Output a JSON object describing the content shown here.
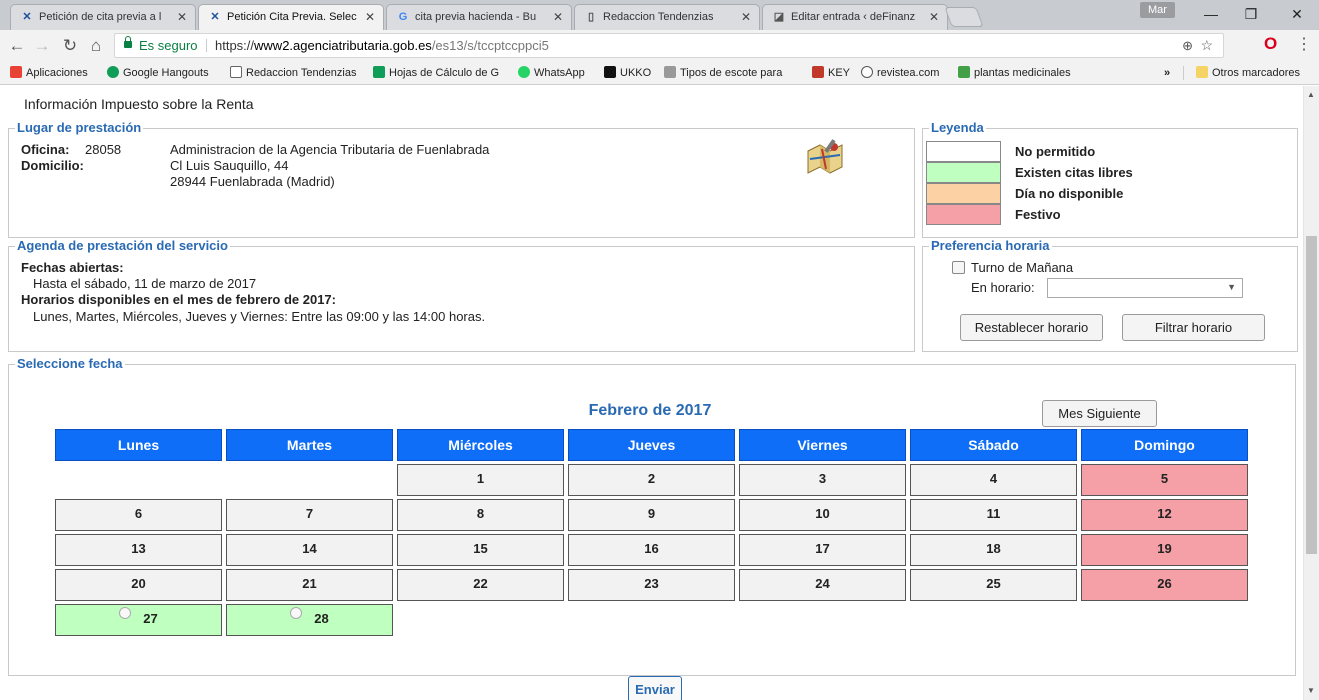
{
  "browser": {
    "tabs": [
      {
        "title": "Petición de cita previa a l",
        "icon": "aeat-icon"
      },
      {
        "title": "Petición Cita Previa. Selec",
        "icon": "aeat-icon"
      },
      {
        "title": "cita previa hacienda - Bu",
        "icon": "google-icon"
      },
      {
        "title": "Redaccion Tendenzias",
        "icon": "document-icon"
      },
      {
        "title": "Editar entrada ‹ deFinanz",
        "icon": "wordpress-icon"
      }
    ],
    "user_chip": "Mar",
    "secure_label": "Es seguro",
    "url_scheme": "https://",
    "url_host": "www2.agenciatributaria.gob.es",
    "url_path": "/es13/s/tccptccppci5",
    "bookmarks": [
      {
        "label": "Aplicaciones",
        "color": "#e94235"
      },
      {
        "label": "Google Hangouts",
        "color": "#0f9d58"
      },
      {
        "label": "Redaccion Tendenzias",
        "color": "#ffffff"
      },
      {
        "label": "Hojas de Cálculo de G",
        "color": "#0f9d58"
      },
      {
        "label": "WhatsApp",
        "color": "#25d366"
      },
      {
        "label": "UKKO",
        "color": "#111111"
      },
      {
        "label": "Tipos de escote para",
        "color": "#777777"
      },
      {
        "label": "KEY",
        "color": "#c0392b"
      },
      {
        "label": "revistea.com",
        "color": "#555555"
      },
      {
        "label": "plantas medicinales",
        "color": "#43a047"
      }
    ],
    "more_bookmarks": "»",
    "other_bookmarks": "Otros marcadores"
  },
  "page": {
    "top_text": "Información Impuesto sobre la Renta",
    "lugar": {
      "legend": "Lugar de prestación",
      "oficina_label": "Oficina:",
      "oficina_code": "28058",
      "oficina_name": "Administracion de la Agencia Tributaria de Fuenlabrada",
      "domicilio_label": "Domicilio:",
      "address_line1": "Cl Luis Sauquillo, 44",
      "address_line2": "28944 Fuenlabrada (Madrid)"
    },
    "leyenda": {
      "legend": "Leyenda",
      "items": [
        {
          "label": "No permitido",
          "color": "#ffffff"
        },
        {
          "label": "Existen citas libres",
          "color": "#bfffbf"
        },
        {
          "label": "Día no disponible",
          "color": "#fcd2a4"
        },
        {
          "label": "Festivo",
          "color": "#f4a0a6"
        }
      ]
    },
    "agenda": {
      "legend": "Agenda de prestación del servicio",
      "fechas_label": "Fechas abiertas:",
      "fechas_value": "Hasta el sábado, 11 de marzo de 2017",
      "horarios_label": "Horarios disponibles en el mes de febrero de 2017:",
      "horarios_value": "Lunes, Martes, Miércoles, Jueves y Viernes: Entre las 09:00 y las 14:00 horas."
    },
    "preferencia": {
      "legend": "Preferencia horaria",
      "turno_label": "Turno de Mañana",
      "horario_label": "En horario:",
      "horario_value": "",
      "reset_button": "Restablecer horario",
      "filter_button": "Filtrar horario"
    },
    "calendario": {
      "legend": "Seleccione fecha",
      "title": "Febrero de 2017",
      "next_button": "Mes Siguiente",
      "weekdays": [
        "Lunes",
        "Martes",
        "Miércoles",
        "Jueves",
        "Viernes",
        "Sábado",
        "Domingo"
      ],
      "weeks": [
        [
          null,
          null,
          "1",
          "2",
          "3",
          "4",
          "5"
        ],
        [
          "6",
          "7",
          "8",
          "9",
          "10",
          "11",
          "12"
        ],
        [
          "13",
          "14",
          "15",
          "16",
          "17",
          "18",
          "19"
        ],
        [
          "20",
          "21",
          "22",
          "23",
          "24",
          "25",
          "26"
        ],
        [
          "27",
          "28",
          null,
          null,
          null,
          null,
          null
        ]
      ],
      "festivos": [
        "5",
        "12",
        "19",
        "26"
      ],
      "libres": [
        "27",
        "28"
      ]
    },
    "submit_button": "Enviar"
  }
}
